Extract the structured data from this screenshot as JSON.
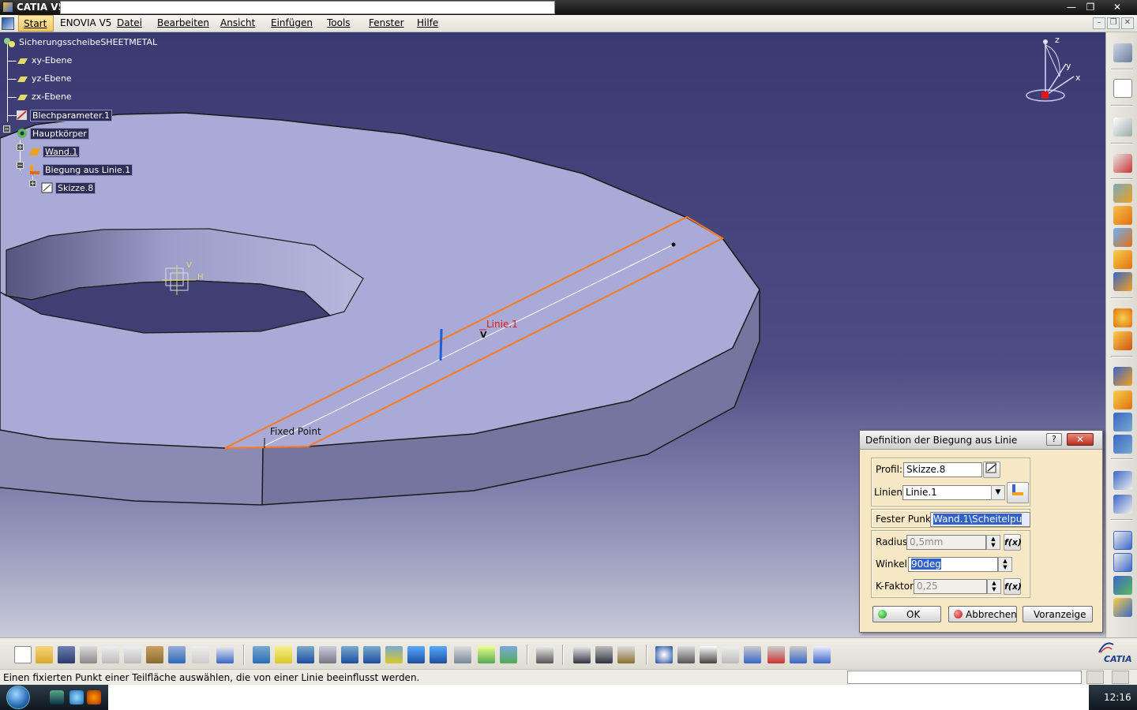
{
  "window": {
    "title": "CATIA V5",
    "controls": [
      "—",
      "❐",
      "✕"
    ]
  },
  "menubar": {
    "items": [
      {
        "label": "Start"
      },
      {
        "label": "ENOVIA V5"
      },
      {
        "label": "Datei"
      },
      {
        "label": "Bearbeiten"
      },
      {
        "label": "Ansicht"
      },
      {
        "label": "Einfügen"
      },
      {
        "label": "Tools"
      },
      {
        "label": "Fenster"
      },
      {
        "label": "Hilfe"
      }
    ],
    "mdi_controls": [
      "–",
      "❐",
      "✕"
    ]
  },
  "tree": {
    "root": "SicherungsscheibeSHEETMETAL",
    "nodes": [
      {
        "label": "xy-Ebene",
        "icon": "plane-icon"
      },
      {
        "label": "yz-Ebene",
        "icon": "plane-icon"
      },
      {
        "label": "zx-Ebene",
        "icon": "plane-icon"
      },
      {
        "label": "Blechparameter.1",
        "icon": "sheetmetal-parameters-icon"
      },
      {
        "label": "Hauptkörper",
        "icon": "body-icon"
      },
      {
        "label": "Wand.1",
        "icon": "wall-icon"
      },
      {
        "label": "Biegung aus Linie.1",
        "icon": "bend-from-line-icon"
      },
      {
        "label": "Skizze.8",
        "icon": "sketch-icon"
      }
    ]
  },
  "viewport": {
    "line_label": "Linie.1",
    "fixed_point_label": "Fixed Point",
    "axis_labels": {
      "z": "z",
      "y": "y",
      "x": "x"
    },
    "sketch_axis_labels": {
      "v": "V",
      "h": "H"
    },
    "colors": {
      "part_top": "#a9aad6",
      "part_side": "#7a7aa4",
      "bend_outline": "#ff7a1e",
      "label_red": "#e01818"
    }
  },
  "dialog": {
    "title": "Definition der Biegung aus Linie",
    "help": "?",
    "close": "✕",
    "profil_label": "Profil:",
    "profil_value": "Skizze.8",
    "linien_label": "Linien:",
    "linien_value": "Linie.1",
    "fester_punkt_label": "Fester Punkt:",
    "fester_punkt_value": "Wand.1\\Scheitelpu",
    "radius_label": "Radius:",
    "radius_value": "0,5mm",
    "winkel_label": "Winkel:",
    "winkel_value": "90deg",
    "kfaktor_label": "K-Faktor:",
    "kfaktor_value": "0,25",
    "ok": "OK",
    "abbrechen": "Abbrechen",
    "voranzeige": "Voranzeige"
  },
  "statusbar": {
    "message": "Einen fixierten Punkt einer Teilfläche auswählen, die von einer Linie beeinflusst werden."
  },
  "taskbar": {
    "clock": "12:16"
  },
  "logo": {
    "text": "CATIA"
  }
}
